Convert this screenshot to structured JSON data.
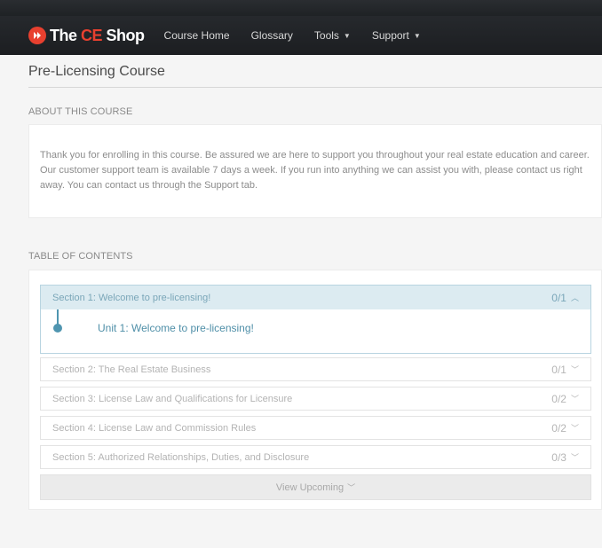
{
  "nav": {
    "logo": {
      "the": "The ",
      "ce": "CE",
      "shop": " Shop"
    },
    "items": [
      {
        "label": "Course Home",
        "dropdown": false
      },
      {
        "label": "Glossary",
        "dropdown": false
      },
      {
        "label": "Tools",
        "dropdown": true
      },
      {
        "label": "Support",
        "dropdown": true
      }
    ]
  },
  "page": {
    "title": "Pre-Licensing Course"
  },
  "about": {
    "heading": "ABOUT THIS COURSE",
    "body": "Thank you for enrolling in this course. Be assured we are here to support you throughout your real estate education and career. Our customer support team is available 7 days a week. If you run into anything we can assist you with, please contact us right away. You can contact us through the Support tab."
  },
  "toc": {
    "heading": "TABLE OF CONTENTS",
    "sections": [
      {
        "label": "Section 1: Welcome to pre-licensing!",
        "count": "0/1",
        "expanded": true,
        "units": [
          {
            "label": "Unit 1: Welcome to pre-licensing!"
          }
        ]
      },
      {
        "label": "Section 2: The Real Estate Business",
        "count": "0/1",
        "expanded": false
      },
      {
        "label": "Section 3: License Law and Qualifications for Licensure",
        "count": "0/2",
        "expanded": false
      },
      {
        "label": "Section 4: License Law and Commission Rules",
        "count": "0/2",
        "expanded": false
      },
      {
        "label": "Section 5: Authorized Relationships, Duties, and Disclosure",
        "count": "0/3",
        "expanded": false
      }
    ],
    "view_upcoming": "View Upcoming"
  },
  "colors": {
    "brand": "#e8402f",
    "accent": "#4f95b0",
    "active_bg": "#dcebf1"
  },
  "icons": {
    "logo": "play-circle-icon",
    "expanded": "chevron-up-icon",
    "collapsed": "chevron-down-icon"
  }
}
